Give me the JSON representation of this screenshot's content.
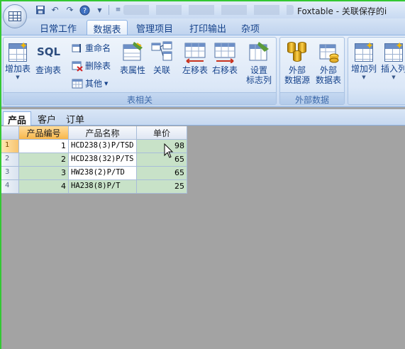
{
  "window": {
    "title": "Foxtable - 关联保存的i",
    "quick_access": [
      "save-icon",
      "undo-icon",
      "redo-icon",
      "help-icon",
      "customize-icon"
    ]
  },
  "ribbon_tabs": [
    {
      "label": "日常工作",
      "active": false
    },
    {
      "label": "数据表",
      "active": true
    },
    {
      "label": "管理项目",
      "active": false
    },
    {
      "label": "打印输出",
      "active": false
    },
    {
      "label": "杂项",
      "active": false
    }
  ],
  "groups": {
    "table": {
      "label": "表相关",
      "add_table": "增加表",
      "query_table": "查询表",
      "rename": "重命名",
      "delete_table": "删除表",
      "other": "其他",
      "table_props": "表属性",
      "relation": "关联",
      "move_left": "左移表",
      "move_right": "右移表",
      "set_flag_col_line1": "设置",
      "set_flag_col_line2": "标志列"
    },
    "external": {
      "label": "外部数据",
      "ext_source_line1": "外部",
      "ext_source_line2": "数据源",
      "ext_table_line1": "外部",
      "ext_table_line2": "数据表"
    },
    "columns": {
      "add_col": "增加列",
      "insert_col": "插入列"
    }
  },
  "doc_tabs": [
    {
      "label": "产品",
      "active": true
    },
    {
      "label": "客户",
      "active": false
    },
    {
      "label": "订单",
      "active": false
    }
  ],
  "grid": {
    "columns": [
      "产品编号",
      "产品名称",
      "单价"
    ],
    "rows": [
      {
        "no": "1",
        "id": "1",
        "name": "HCD238(3)P/TSD",
        "price": "98"
      },
      {
        "no": "2",
        "id": "2",
        "name": "HCD238(32)P/TS",
        "price": "65"
      },
      {
        "no": "3",
        "id": "3",
        "name": "HW238(2)P/TD",
        "price": "65"
      },
      {
        "no": "4",
        "id": "4",
        "name": "HA238(8)P/T",
        "price": "25"
      }
    ]
  },
  "colors": {
    "ribbon_text": "#15428b",
    "workspace": "#a3a3a3",
    "row_alt": "#c8e2c8",
    "header_selected": "#f7b64b"
  }
}
